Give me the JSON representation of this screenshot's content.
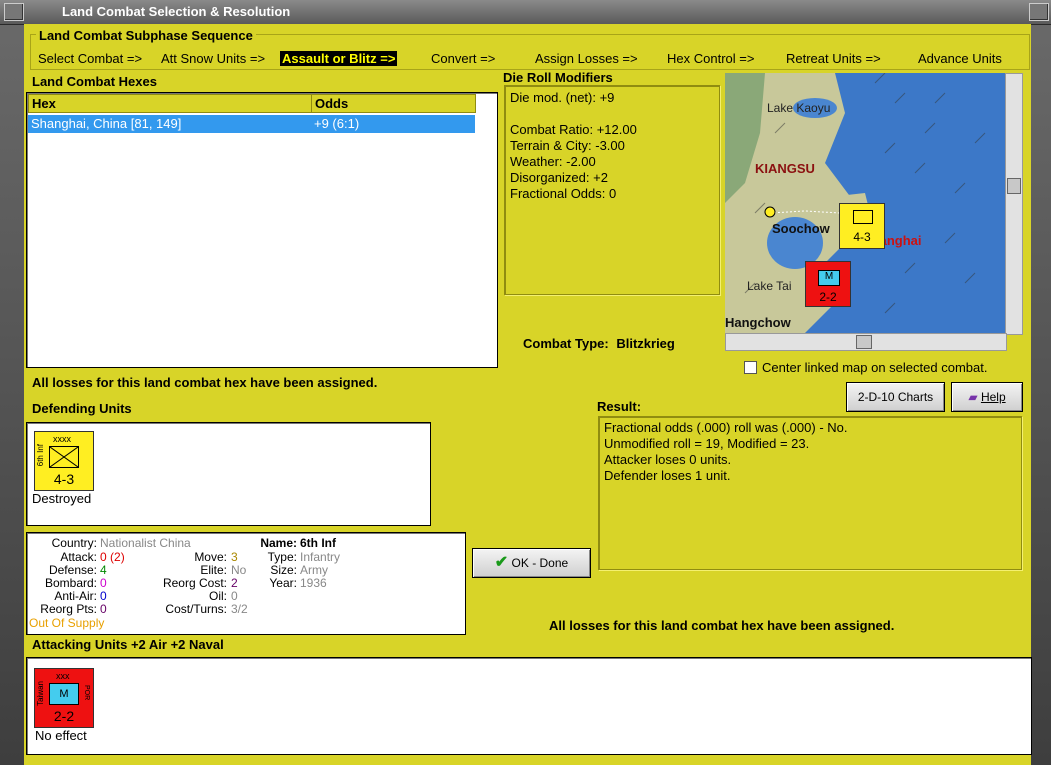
{
  "window": {
    "title": "Land Combat Selection & Resolution"
  },
  "sequence": {
    "title": "Land Combat Subphase Sequence",
    "items": [
      {
        "label": "Select Combat =>",
        "active": false
      },
      {
        "label": "Att Snow Units =>",
        "active": false
      },
      {
        "label": "Assault or Blitz =>",
        "active": true
      },
      {
        "label": "Convert =>",
        "active": false
      },
      {
        "label": "Assign Losses =>",
        "active": false
      },
      {
        "label": "Hex Control =>",
        "active": false
      },
      {
        "label": "Retreat Units =>",
        "active": false
      },
      {
        "label": "Advance Units",
        "active": false
      }
    ]
  },
  "hexes": {
    "title": "Land Combat Hexes",
    "col_hex": "Hex",
    "col_odds": "Odds",
    "rows": [
      {
        "hex": "Shanghai, China [81, 149]",
        "odds": "+9 (6:1)"
      }
    ]
  },
  "modifiers": {
    "title": "Die Roll Modifiers",
    "lines": [
      "Die mod. (net): +9",
      "",
      "Combat Ratio: +12.00",
      "Terrain & City: -3.00",
      "Weather: -2.00",
      "Disorganized: +2",
      "Fractional Odds: 0"
    ]
  },
  "map": {
    "labels": {
      "lake_kaoyu": "Lake Kaoyu",
      "kiangsu": "KIANGSU",
      "soochow": "Soochow",
      "shanghai": "Shanghai",
      "lake_tai": "Lake Tai",
      "hangchow": "Hangchow"
    },
    "center_linked_label": "Center linked map on selected combat.",
    "center_linked_checked": false
  },
  "combat_type": {
    "label": "Combat Type:",
    "value": "Blitzkrieg"
  },
  "losses_msg": "All losses for this land combat hex have been assigned.",
  "defending": {
    "title": "Defending Units",
    "unit": {
      "xxx": "xxxx",
      "side": "6th Inf",
      "value": "4-3",
      "status": "Destroyed",
      "color": "#ffee22"
    }
  },
  "stats": {
    "country_label": "Country:",
    "country": "Nationalist China",
    "attack_label": "Attack:",
    "attack": "0",
    "attack_mod": "(2)",
    "defense_label": "Defense:",
    "defense": "4",
    "bombard_label": "Bombard:",
    "bombard": "0",
    "antiair_label": "Anti-Air:",
    "antiair": "0",
    "reorgpts_label": "Reorg Pts:",
    "reorgpts": "0",
    "supply": "Out Of Supply",
    "move_label": "Move:",
    "move": "3",
    "elite_label": "Elite:",
    "elite": "No",
    "reorgcost_label": "Reorg Cost:",
    "reorgcost": "2",
    "oil_label": "Oil:",
    "oil": "0",
    "costturns_label": "Cost/Turns:",
    "costturns": "3/2",
    "name_label": "Name:",
    "name": "6th Inf",
    "type_label": "Type:",
    "type": "Infantry",
    "size_label": "Size:",
    "size": "Army",
    "year_label": "Year:",
    "year": "1936"
  },
  "buttons": {
    "charts": "2-D-10 Charts",
    "help": "Help",
    "ok": "OK - Done"
  },
  "result": {
    "title": "Result:",
    "lines": [
      "Fractional odds (.000) roll was (.000)  - No.",
      "Unmodified roll = 19, Modified = 23.",
      "Attacker loses 0 units.",
      "Defender loses 1 unit."
    ]
  },
  "attacking": {
    "title": "Attacking Units +2 Air +2 Naval",
    "unit": {
      "xxx": "xxx",
      "side": "Taiwan",
      "corner": "POR",
      "symbol": "M",
      "value": "2-2",
      "status": "No effect",
      "color": "#ee1111"
    }
  },
  "colors": {
    "panel": "#d8d428",
    "selection": "#3399ee",
    "sequence_active_bg": "#000000",
    "sequence_active_fg": "#ffff00"
  }
}
